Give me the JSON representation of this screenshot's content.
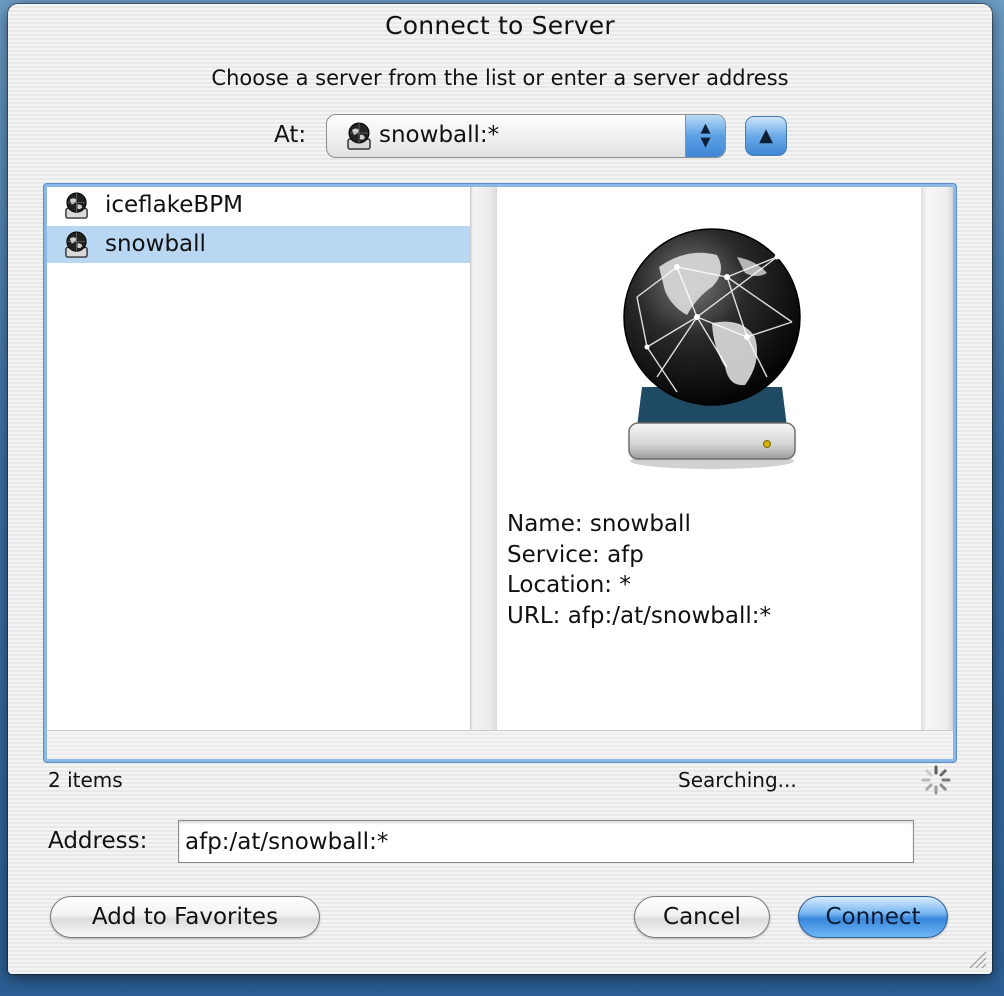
{
  "window": {
    "title": "Connect to Server"
  },
  "prompt": "Choose a server from the list or enter a server address",
  "at": {
    "label": "At:",
    "selected": "snowball:*",
    "icon": "server-globe-icon"
  },
  "browser": {
    "servers": [
      {
        "name": "iceflakeBPM",
        "icon": "server-globe-icon",
        "selected": false
      },
      {
        "name": "snowball",
        "icon": "server-globe-icon",
        "selected": true
      }
    ],
    "details": {
      "icon": "network-globe-drive-icon",
      "name_line": "Name: snowball",
      "service_line": "Service: afp",
      "location_line": "Location: *",
      "url_line": "URL: afp:/at/snowball:*"
    }
  },
  "status": {
    "count": "2 items",
    "activity": "Searching..."
  },
  "address": {
    "label": "Address:",
    "value": "afp:/at/snowball:*"
  },
  "buttons": {
    "add_favorites": "Add to Favorites",
    "cancel": "Cancel",
    "connect": "Connect"
  },
  "colors": {
    "selection": "#b9d6f3",
    "aqua_blue": "#3f86d6",
    "desktop": "#3f72a6"
  }
}
